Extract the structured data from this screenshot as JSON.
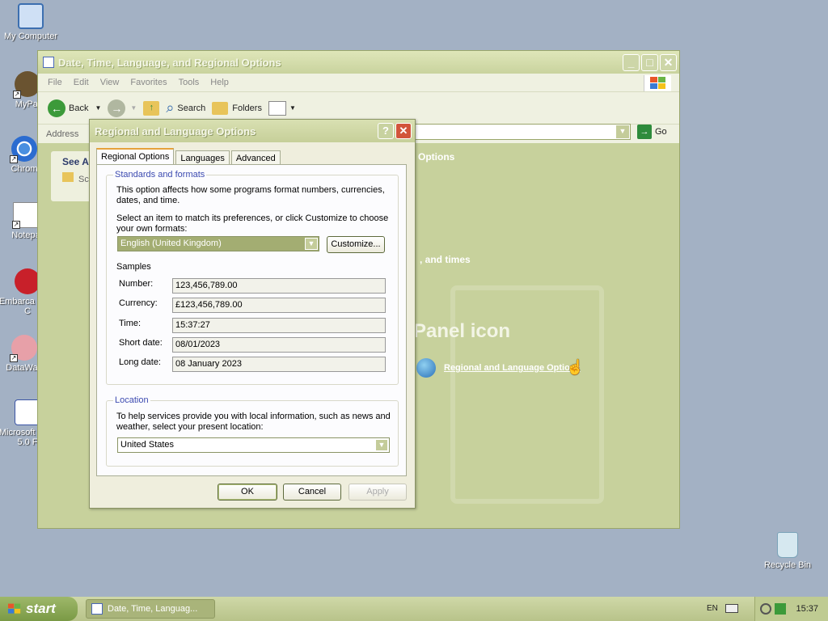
{
  "desktop": {
    "icons": [
      {
        "label": "My Computer"
      },
      {
        "label": "MyPal"
      },
      {
        "label": "Chrom"
      },
      {
        "label": "Notepa"
      },
      {
        "label": "Embarca Dev-C"
      },
      {
        "label": "DataWag"
      },
      {
        "label": "Microsoft CPP 5.0 F"
      },
      {
        "label": "Recycle Bin"
      }
    ]
  },
  "explorer": {
    "title": "Date, Time, Language, and Regional Options",
    "menu": [
      "File",
      "Edit",
      "View",
      "Favorites",
      "Tools",
      "Help"
    ],
    "toolbar": {
      "back": "Back",
      "search": "Search",
      "folders": "Folders"
    },
    "address_label": "Address",
    "go_label": "Go",
    "see_also": "See Al",
    "see_also_item": "Sc",
    "content": {
      "header_fragment": "Options",
      "task_fragment": ", and times",
      "panel_fragment": "Panel icon",
      "link": "Regional and Language Options"
    }
  },
  "dialog": {
    "title": "Regional and Language Options",
    "tabs": [
      "Regional Options",
      "Languages",
      "Advanced"
    ],
    "standards": {
      "legend": "Standards and formats",
      "desc": "This option affects how some programs format numbers, currencies, dates, and time.",
      "select_desc": "Select an item to match its preferences, or click Customize to choose your own formats:",
      "format_value": "English (United Kingdom)",
      "customize": "Customize...",
      "samples_label": "Samples",
      "samples": [
        {
          "label": "Number:",
          "value": "123,456,789.00"
        },
        {
          "label": "Currency:",
          "value": "£123,456,789.00"
        },
        {
          "label": "Time:",
          "value": "15:37:27"
        },
        {
          "label": "Short date:",
          "value": "08/01/2023"
        },
        {
          "label": "Long date:",
          "value": "08 January 2023"
        }
      ]
    },
    "location": {
      "legend": "Location",
      "desc": "To help services provide you with local information, such as news and weather, select your present location:",
      "value": "United States"
    },
    "buttons": {
      "ok": "OK",
      "cancel": "Cancel",
      "apply": "Apply"
    }
  },
  "taskbar": {
    "start": "start",
    "task": "Date, Time, Languag...",
    "lang": "EN",
    "clock": "15:37"
  }
}
